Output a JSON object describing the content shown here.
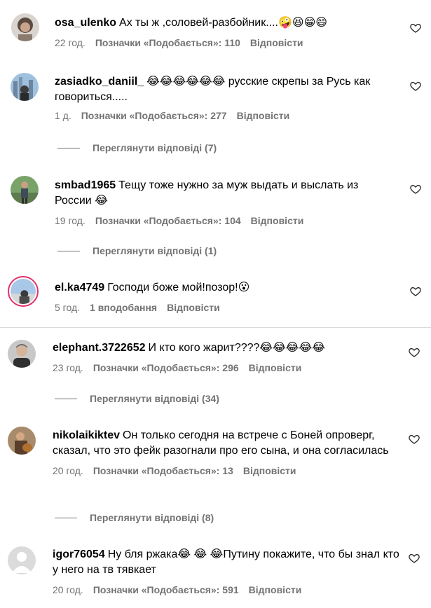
{
  "comments": [
    {
      "username": "osa_ulenko",
      "text": "Ах ты ж ,соловей-разбойник....🤪😆😁😄",
      "time": "22 год.",
      "likes": "Позначки «Подобається»: 110",
      "reply": "Відповісти",
      "avatar_icon": "profile-photo-curly-hair"
    },
    {
      "username": "zasiadko_daniil_",
      "text": "😂😂😂😂😂😂 русские скрепы за Русь как говориться.....",
      "time": "1 д.",
      "likes": "Позначки «Подобається»: 277",
      "reply": "Відповісти",
      "view_replies": "Переглянути відповіді (7)",
      "avatar_icon": "profile-photo-city"
    },
    {
      "username": "smbad1965",
      "text": "Тещу тоже нужно за муж выдать и выслать из России 😂",
      "time": "19 год.",
      "likes": "Позначки «Подобається»: 104",
      "reply": "Відповісти",
      "view_replies": "Переглянути відповіді (1)",
      "avatar_icon": "profile-photo-person-outdoors"
    },
    {
      "username": "el.ka4749",
      "text": "Господи боже мой!позор!😮",
      "time": "5 год.",
      "likes": "1 вподобання",
      "reply": "Відповісти",
      "avatar_icon": "profile-photo-story-ring"
    },
    {
      "username": "elephant.3722652",
      "text": "И кто кого жарит????😂😂😂😂😂",
      "time": "23 год.",
      "likes": "Позначки «Подобається»: 296",
      "reply": "Відповісти",
      "view_replies": "Переглянути відповіді (34)",
      "avatar_icon": "profile-photo-man"
    },
    {
      "username": "nikolaikiktev",
      "text": "Он только сегодня на встрече с Боней опроверг, сказал, что это фейк разогнали про его сына, и она согласилась",
      "time": "20 год.",
      "likes": "Позначки «Подобається»: 13",
      "reply": "Відповісти",
      "view_replies": "Переглянути відповіді (8)",
      "avatar_icon": "profile-photo-man-guitar"
    },
    {
      "username": "igor76054",
      "text": "Ну бля ржака😂 😂 😂Путину покажите, что бы знал кто у него на тв тявкает",
      "time": "20 год.",
      "likes": "Позначки «Подобається»: 591",
      "reply": "Відповісти",
      "avatar_icon": "default-avatar-icon"
    }
  ],
  "colors": {
    "meta_gray": "#737373",
    "divider": "#dbdbdb",
    "story_ring": "#e1306c"
  },
  "icons": {
    "like": "heart-outline-icon"
  }
}
